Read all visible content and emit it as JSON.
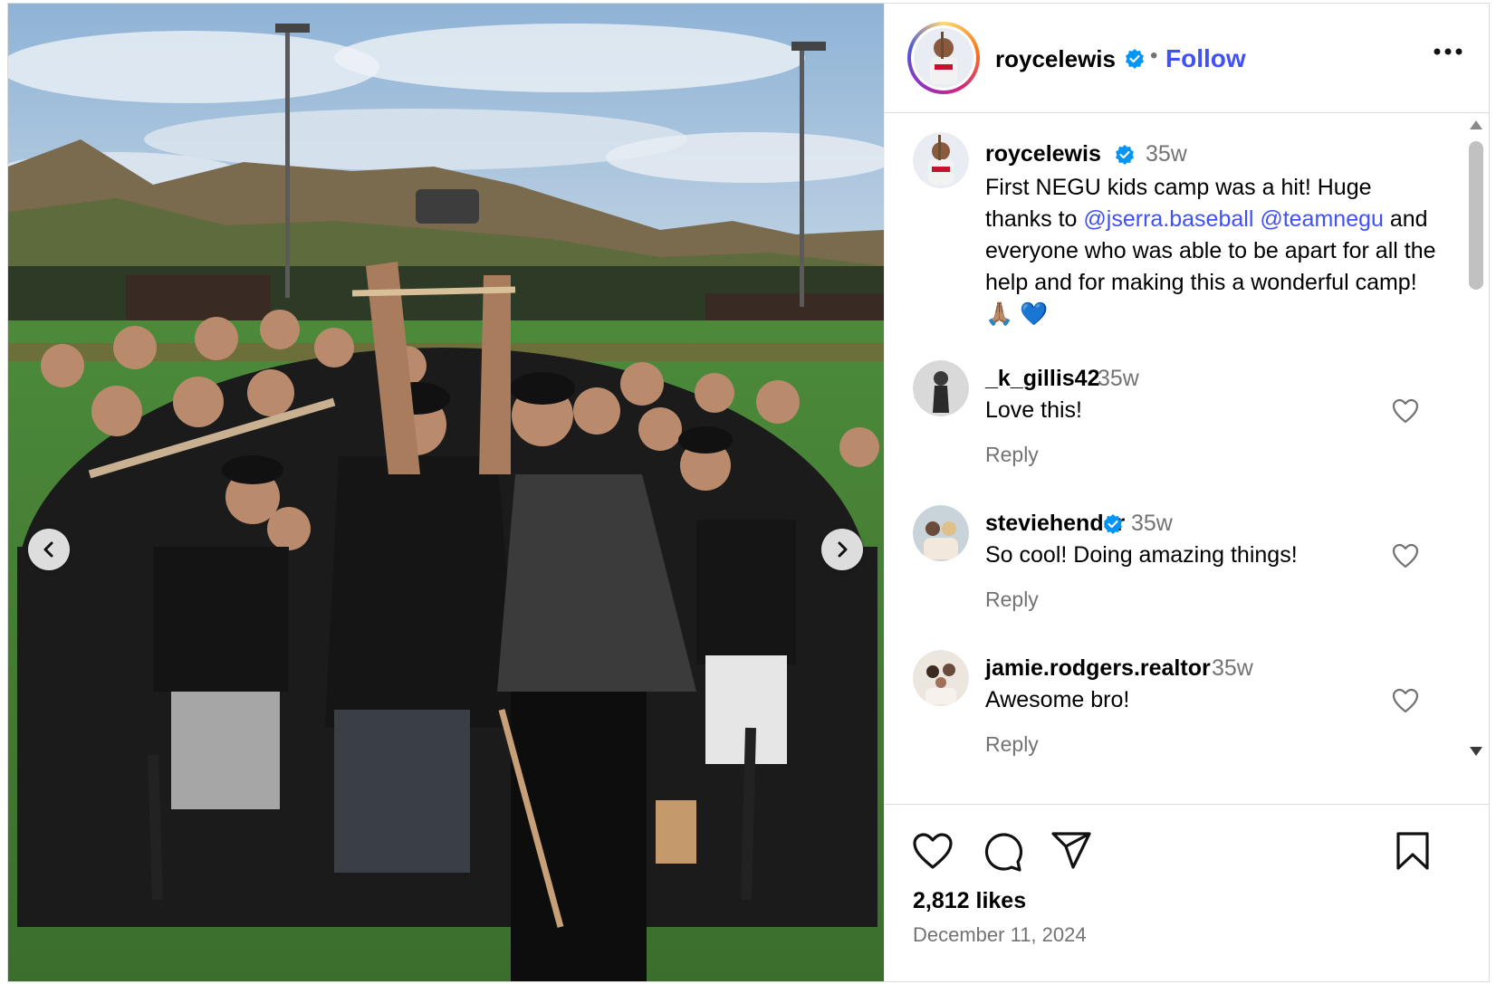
{
  "post": {
    "username": "roycelewis",
    "follow_label": "Follow",
    "dot": "•",
    "caption_time": "35w",
    "caption_parts": {
      "before": "First NEGU kids camp was a hit! Huge thanks to ",
      "mention1": "@jserra.baseball",
      "space": " ",
      "mention2": "@teamnegu",
      "after": " and everyone who was able to be apart for all the help and for making this a wonderful camp! 🙏🏽 💙"
    },
    "likes": "2,812 likes",
    "date": "December 11, 2024"
  },
  "comments": [
    {
      "user": "_k_gillis42",
      "time": "35w",
      "text": "Love this!",
      "reply": "Reply",
      "verified": false
    },
    {
      "user": "steviehender",
      "time": "35w",
      "text": "So cool! Doing amazing things!",
      "reply": "Reply",
      "verified": true
    },
    {
      "user": "jamie.rodgers.realtor",
      "time": "35w",
      "text": "Awesome bro!",
      "reply": "Reply",
      "verified": false
    }
  ],
  "icons": {
    "verified": "verified-badge-icon",
    "more": "more-options-icon",
    "like": "heart-icon",
    "comment": "comment-icon",
    "share": "share-icon",
    "save": "bookmark-icon",
    "prev": "chevron-left-icon",
    "next": "chevron-right-icon"
  },
  "colors": {
    "link": "#4150f7",
    "verified": "#0095f6",
    "muted": "#737373"
  }
}
